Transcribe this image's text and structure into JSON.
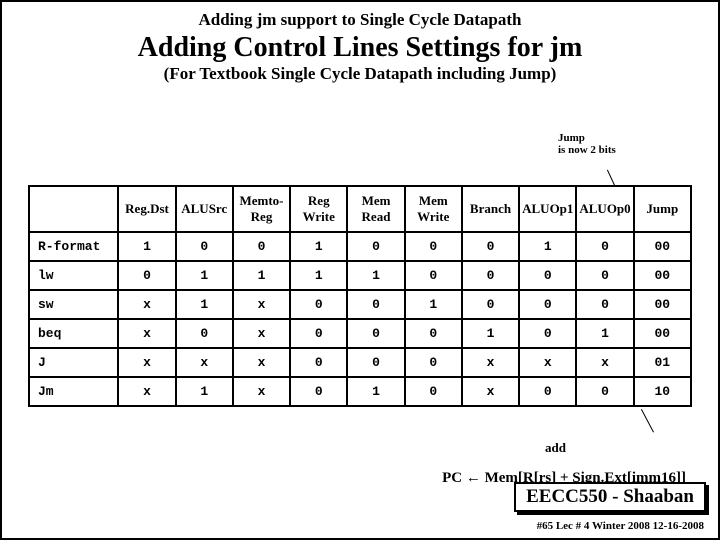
{
  "header": {
    "sup_title": "Adding  jm support to Single Cycle Datapath",
    "main_title": "Adding Control Lines Settings for jm",
    "sub_title": "(For Textbook Single Cycle Datapath including Jump)"
  },
  "note": {
    "line1": "Jump",
    "line2": "is now 2 bits"
  },
  "table": {
    "headers": [
      "",
      "Reg.Dst",
      "ALUSrc",
      "Memto-Reg",
      "Reg Write",
      "Mem Read",
      "Mem Write",
      "Branch",
      "ALUOp1",
      "ALUOp0",
      "Jump"
    ],
    "rows": [
      {
        "label": "R-format",
        "cells": [
          "1",
          "0",
          "0",
          "1",
          "0",
          "0",
          "0",
          "1",
          "0",
          "00"
        ]
      },
      {
        "label": "lw",
        "cells": [
          "0",
          "1",
          "1",
          "1",
          "1",
          "0",
          "0",
          "0",
          "0",
          "00"
        ]
      },
      {
        "label": "sw",
        "cells": [
          "x",
          "1",
          "x",
          "0",
          "0",
          "1",
          "0",
          "0",
          "0",
          "00"
        ]
      },
      {
        "label": "beq",
        "cells": [
          "x",
          "0",
          "x",
          "0",
          "0",
          "0",
          "1",
          "0",
          "1",
          "00"
        ]
      },
      {
        "label": "J",
        "cells": [
          "x",
          "x",
          "x",
          "0",
          "0",
          "0",
          "x",
          "x",
          "x",
          "01"
        ]
      },
      {
        "label": "Jm",
        "cells": [
          "x",
          "1",
          "x",
          "0",
          "1",
          "0",
          "x",
          "0",
          "0",
          "10"
        ]
      }
    ]
  },
  "annotations": {
    "add": "add",
    "pc": "PC   ←  Mem[R[rs] + Sign.Ext[imm16]]"
  },
  "footer": {
    "box": "EECC550 - Shaaban",
    "meta": "#65   Lec # 4   Winter 2008   12-16-2008"
  }
}
